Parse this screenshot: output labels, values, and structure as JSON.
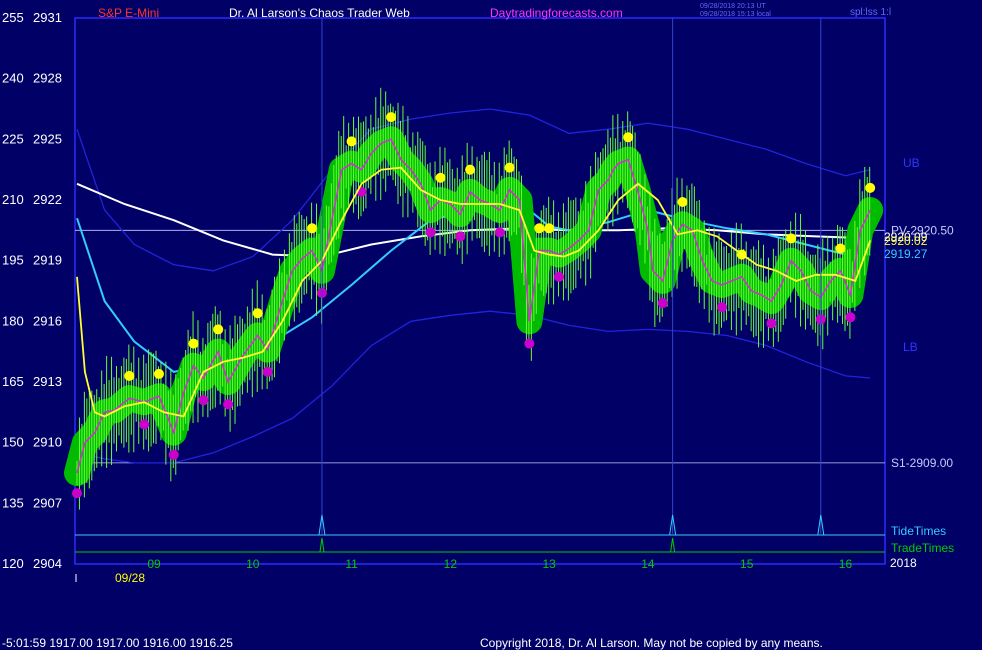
{
  "header": {
    "instrument": "S&P E-Mini",
    "site_title": "Dr. Al Larson's Chaos Trader Web",
    "site_url": "Daytradingforecasts.com",
    "timestamp_ut": "09/28/2018 20:13 UT",
    "timestamp_local": "09/28/2018 15:13 local",
    "bar_interval": "spl:lss 1:l"
  },
  "footer": {
    "quote": "-5:01:59  1917.00 1917.00 1916.00 1916.25",
    "copyright": "Copyright 2018, Dr. Al Larson. May not be copied by any means."
  },
  "colors": {
    "background": "#000066",
    "plot_frame": "#2a2aff",
    "price": "#00cc00",
    "price_band": "#00bb00",
    "swing_high": "#ffff00",
    "swing_low": "#cc00cc",
    "fast_avg": "#ffff33",
    "slow_avg": "#ffffff",
    "cyan_avg": "#33ccff",
    "bands": "#2222dd",
    "tide": "#33ccff",
    "trade": "#00cc00"
  },
  "chart_data": {
    "type": "line",
    "date_label": "09/28",
    "year_label": "2018",
    "ylim": [
      2904,
      2931
    ],
    "y_ticks": [
      {
        "value": 2931,
        "left": "255",
        "right": "2931"
      },
      {
        "value": 2928,
        "left": "240",
        "right": "2928"
      },
      {
        "value": 2925,
        "left": "225",
        "right": "2925"
      },
      {
        "value": 2922,
        "left": "210",
        "right": "2922"
      },
      {
        "value": 2919,
        "left": "195",
        "right": "2919"
      },
      {
        "value": 2916,
        "left": "180",
        "right": "2916"
      },
      {
        "value": 2913,
        "left": "165",
        "right": "2913"
      },
      {
        "value": 2910,
        "left": "150",
        "right": "2910"
      },
      {
        "value": 2907,
        "left": "135",
        "right": "2907"
      },
      {
        "value": 2904,
        "left": "120",
        "right": "2904"
      }
    ],
    "xlim": [
      8.0,
      16.2
    ],
    "x_ticks": [
      "09",
      "10",
      "11",
      "12",
      "13",
      "14",
      "15",
      "16"
    ],
    "x_tick_values": [
      8.8,
      9.8,
      10.8,
      11.8,
      12.8,
      13.8,
      14.8,
      15.8
    ],
    "levels": [
      {
        "label": "PV-2920.50",
        "value": 2920.5
      },
      {
        "label": "S1-2909.00",
        "value": 2909.0
      }
    ],
    "band_labels": {
      "upper": "UB",
      "lower": "LB"
    },
    "last_values": {
      "slow": "2920.09",
      "fast": "2920.02",
      "cyan": "2919.27"
    },
    "price": {
      "x": [
        8.02,
        8.1,
        8.2,
        8.3,
        8.4,
        8.55,
        8.7,
        8.85,
        9.0,
        9.1,
        9.2,
        9.3,
        9.45,
        9.55,
        9.7,
        9.85,
        9.95,
        10.1,
        10.2,
        10.3,
        10.4,
        10.5,
        10.6,
        10.7,
        10.8,
        10.9,
        11.0,
        11.1,
        11.2,
        11.3,
        11.4,
        11.5,
        11.6,
        11.7,
        11.8,
        11.9,
        12.0,
        12.1,
        12.2,
        12.3,
        12.4,
        12.5,
        12.55,
        12.6,
        12.7,
        12.8,
        12.9,
        13.0,
        13.1,
        13.2,
        13.3,
        13.4,
        13.45,
        13.5,
        13.6,
        13.7,
        13.8,
        13.85,
        13.95,
        14.05,
        14.15,
        14.25,
        14.35,
        14.45,
        14.55,
        14.65,
        14.75,
        14.85,
        14.95,
        15.05,
        15.15,
        15.25,
        15.35,
        15.45,
        15.55,
        15.65,
        15.75,
        15.85,
        15.95,
        16.05
      ],
      "y": [
        2908.5,
        2910.0,
        2910.5,
        2911.5,
        2911.6,
        2912.2,
        2912.0,
        2912.3,
        2910.5,
        2912.5,
        2913.8,
        2913.2,
        2914.5,
        2913.0,
        2914.3,
        2915.3,
        2914.6,
        2917.0,
        2918.5,
        2919.1,
        2919.5,
        2918.5,
        2921.0,
        2923.5,
        2923.8,
        2923.5,
        2924.3,
        2924.8,
        2925.0,
        2924.0,
        2923.5,
        2922.8,
        2921.5,
        2922.0,
        2921.8,
        2921.3,
        2922.4,
        2922.0,
        2921.8,
        2921.5,
        2922.5,
        2922.0,
        2919.0,
        2916.0,
        2919.5,
        2919.5,
        2919.3,
        2919.6,
        2920.0,
        2920.5,
        2922.5,
        2923.0,
        2923.5,
        2923.8,
        2924.0,
        2922.4,
        2920.5,
        2918.5,
        2918.0,
        2920.0,
        2920.8,
        2920.5,
        2919.0,
        2918.0,
        2917.8,
        2918.0,
        2918.2,
        2917.5,
        2917.3,
        2917.0,
        2917.8,
        2919.0,
        2918.5,
        2917.5,
        2917.2,
        2918.0,
        2918.5,
        2917.3,
        2920.5,
        2921.5
      ]
    },
    "fast_avg": {
      "x": [
        8.02,
        8.1,
        8.2,
        8.3,
        8.5,
        8.7,
        8.9,
        9.1,
        9.3,
        9.5,
        9.7,
        9.9,
        10.1,
        10.3,
        10.5,
        10.7,
        10.9,
        11.1,
        11.3,
        11.5,
        11.7,
        11.9,
        12.1,
        12.3,
        12.5,
        12.65,
        12.8,
        12.95,
        13.1,
        13.3,
        13.5,
        13.7,
        13.9,
        14.1,
        14.3,
        14.5,
        14.7,
        14.9,
        15.1,
        15.3,
        15.5,
        15.7,
        15.9,
        16.05
      ],
      "y": [
        2918.2,
        2913.5,
        2911.5,
        2911.3,
        2911.8,
        2912.0,
        2911.5,
        2911.3,
        2913.5,
        2914.0,
        2914.2,
        2914.5,
        2916.0,
        2918.0,
        2919.0,
        2921.0,
        2922.8,
        2923.5,
        2923.6,
        2922.5,
        2922.0,
        2921.8,
        2921.8,
        2921.8,
        2921.5,
        2919.5,
        2919.3,
        2919.2,
        2919.5,
        2920.5,
        2922.0,
        2922.8,
        2922.0,
        2920.3,
        2920.5,
        2920.2,
        2919.5,
        2918.8,
        2918.5,
        2918.0,
        2918.3,
        2918.3,
        2918.0,
        2920.0
      ]
    },
    "slow_avg": {
      "x": [
        8.02,
        8.5,
        9.0,
        9.5,
        10.0,
        10.5,
        11.0,
        11.5,
        12.0,
        12.5,
        13.0,
        13.5,
        14.0,
        14.5,
        15.0,
        15.5,
        16.05
      ],
      "y": [
        2922.8,
        2921.8,
        2921.0,
        2920.0,
        2919.3,
        2919.2,
        2919.8,
        2920.2,
        2920.5,
        2920.6,
        2920.5,
        2920.5,
        2920.6,
        2920.5,
        2920.3,
        2920.2,
        2920.1
      ]
    },
    "cyan_avg": {
      "x": [
        8.02,
        8.3,
        8.6,
        9.0,
        9.3,
        9.6,
        10.0,
        10.4,
        10.8,
        11.2,
        11.6,
        12.0,
        12.4,
        12.6,
        12.8,
        13.0,
        13.4,
        13.8,
        14.2,
        14.6,
        15.0,
        15.4,
        15.8,
        16.05
      ],
      "y": [
        2921.1,
        2917.0,
        2915.0,
        2913.5,
        2913.8,
        2914.5,
        2915.0,
        2916.2,
        2917.8,
        2919.5,
        2921.0,
        2921.5,
        2921.8,
        2921.5,
        2920.7,
        2920.5,
        2920.9,
        2921.5,
        2921.0,
        2920.6,
        2920.3,
        2919.8,
        2919.3,
        2919.3
      ]
    },
    "upper_band": {
      "x": [
        8.02,
        8.3,
        8.6,
        9.0,
        9.4,
        9.8,
        10.2,
        10.6,
        11.0,
        11.4,
        11.8,
        12.2,
        12.6,
        13.0,
        13.4,
        13.8,
        14.2,
        14.6,
        15.0,
        15.4,
        15.8,
        16.05
      ],
      "y": [
        2925.5,
        2921.5,
        2919.8,
        2918.8,
        2918.5,
        2919.2,
        2921.0,
        2923.5,
        2925.5,
        2926.0,
        2926.3,
        2926.5,
        2926.2,
        2925.3,
        2925.5,
        2925.8,
        2925.5,
        2925.0,
        2924.5,
        2923.8,
        2923.2,
        2923.5
      ]
    },
    "lower_band": {
      "x": [
        8.02,
        8.3,
        8.6,
        9.0,
        9.4,
        9.8,
        10.2,
        10.6,
        11.0,
        11.4,
        11.8,
        12.2,
        12.6,
        13.0,
        13.4,
        13.8,
        14.2,
        14.6,
        15.0,
        15.4,
        15.8,
        16.05
      ],
      "y": [
        2909.5,
        2909.2,
        2909.0,
        2909.0,
        2909.5,
        2910.3,
        2911.2,
        2912.8,
        2914.8,
        2916.0,
        2916.3,
        2916.5,
        2916.3,
        2915.8,
        2915.5,
        2915.6,
        2915.5,
        2915.3,
        2914.8,
        2914.0,
        2913.3,
        2913.2
      ]
    },
    "tide_times": [
      10.5,
      14.05,
      15.55
    ],
    "trade_times": [
      10.5,
      14.05
    ],
    "cycle_labels": {
      "tide": "TideTimes",
      "trade": "TradeTimes"
    }
  }
}
